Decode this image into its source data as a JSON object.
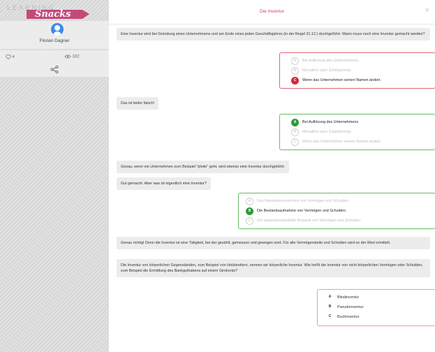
{
  "logo": {
    "top": "LEARNING",
    "word": "Snacks"
  },
  "user": {
    "name": "Florian Dagner",
    "likes": "4",
    "views": "332"
  },
  "header": {
    "title": "Die Inventur",
    "close": "×"
  },
  "messages": [
    "Eine Inventur wird bei Gründung eines Unternehmens und am Ende eines jeden Geschäftsjahres (in der Regel 31.12.) durchgeführt. Wann muss noch eine Inventur gemacht werden?",
    "Das ist leider falsch!",
    "Genau, wenn ein Unternehmen zum Beispiel \"pleite\" geht, wird ebenso eine Inventur durchgeführt.",
    "Gut gemacht. Aber was ist eigentlich eine Inventur?",
    "Genau richtig! Denn die Inventur ist eine Tätigkeit, bei der gezählt, gemessen und gewogen wird. Für alle Vermögensteile und Schulden wird so der Wert ermittelt.",
    "Die Inventur von körperlichen Gegenständen, zum Beispiel von Holzbrettern, nennen wir körperliche Inventur. Wie heißt die Inventur von nicht körperlichen Vermögen oder Schulden, zum Beispiel die Ermittlung des Bankguthabens auf einem Girokonto?"
  ],
  "answers1": [
    {
      "letter": "A",
      "text": "Bei Auflösung des Unternehmens"
    },
    {
      "letter": "B",
      "text": "Monatlich nach Zufallsprinzip"
    },
    {
      "letter": "C",
      "text": "Wenn das Unternehmen seinen Namen ändert."
    }
  ],
  "answers2": [
    {
      "letter": "A",
      "text": "Bei Auflösung des Unternehmens"
    },
    {
      "letter": "B",
      "text": "Monatlich nach Zufallsprinzip"
    },
    {
      "letter": "C",
      "text": "Wenn das Unternehmen seinen Namen ändert."
    }
  ],
  "answers3": [
    {
      "letter": "A",
      "text": "Das Bestandsverzeichnis von Vermögen und Schulden."
    },
    {
      "letter": "B",
      "text": "Die Bestandsaufnahme von Vermögen und Schulden."
    },
    {
      "letter": "C",
      "text": "Der gegenübergestellte Bestand von Vermögen und Schulden."
    }
  ],
  "answers4": [
    {
      "letter": "A",
      "text": "Blindinventur"
    },
    {
      "letter": "B",
      "text": "Pseudoinventur"
    },
    {
      "letter": "C",
      "text": "Buchinventur"
    }
  ],
  "colors": {
    "accent": "#c4497a",
    "wrong": "#d7263d",
    "correct": "#2e9a3a"
  }
}
